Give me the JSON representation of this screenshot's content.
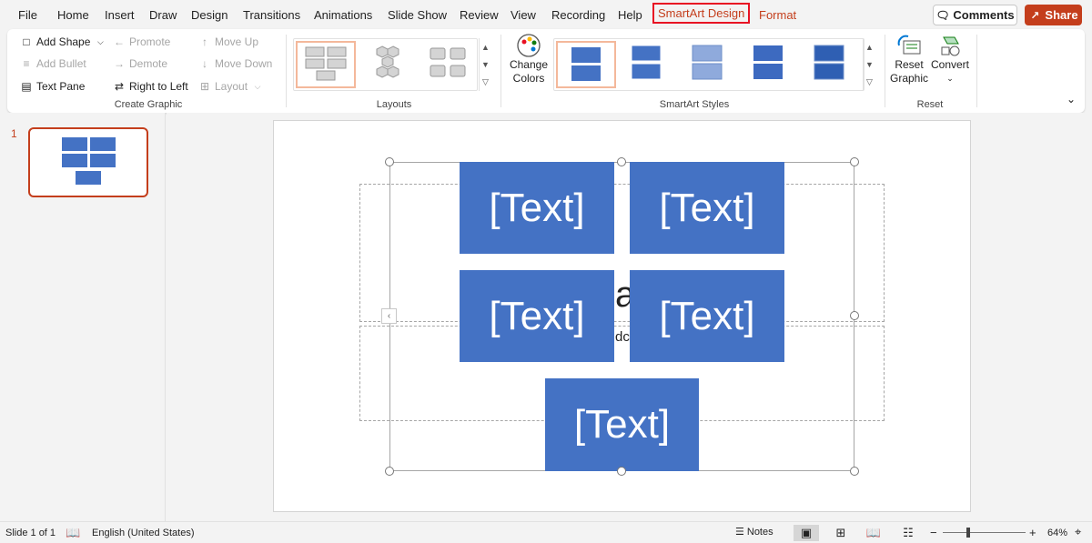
{
  "menu": {
    "tabs": [
      "File",
      "Home",
      "Insert",
      "Draw",
      "Design",
      "Transitions",
      "Animations",
      "Slide Show",
      "Review",
      "View",
      "Recording",
      "Help",
      "SmartArt Design",
      "Format"
    ],
    "comments": "Comments",
    "share": "Share"
  },
  "ribbon": {
    "create_graphic": {
      "add_shape": "Add Shape",
      "add_bullet": "Add Bullet",
      "text_pane": "Text Pane",
      "promote": "Promote",
      "demote": "Demote",
      "right_to_left": "Right to Left",
      "move_up": "Move Up",
      "move_down": "Move Down",
      "layout": "Layout",
      "label": "Create Graphic"
    },
    "layouts": {
      "label": "Layouts"
    },
    "styles": {
      "change_colors_line1": "Change",
      "change_colors_line2": "Colors",
      "label": "SmartArt Styles"
    },
    "reset": {
      "reset_graphic_line1": "Reset",
      "reset_graphic_line2": "Graphic",
      "convert": "Convert",
      "label": "Reset"
    }
  },
  "thumbnails": {
    "slide_number": "1"
  },
  "slide": {
    "boxes": [
      "[Text]",
      "[Text]",
      "[Text]",
      "[Text]",
      "[Text]"
    ],
    "behind_title_fragment": "a",
    "behind_subtitle_fragment": "dc",
    "smartart_fill": "#4472c4"
  },
  "status": {
    "slide_info": "Slide 1 of 1",
    "language": "English (United States)",
    "notes": "Notes",
    "zoom": "64%",
    "zoom_level_fraction": 0.31
  },
  "colors": {
    "accent": "#c43e1c",
    "highlight_border": "#e81123"
  }
}
